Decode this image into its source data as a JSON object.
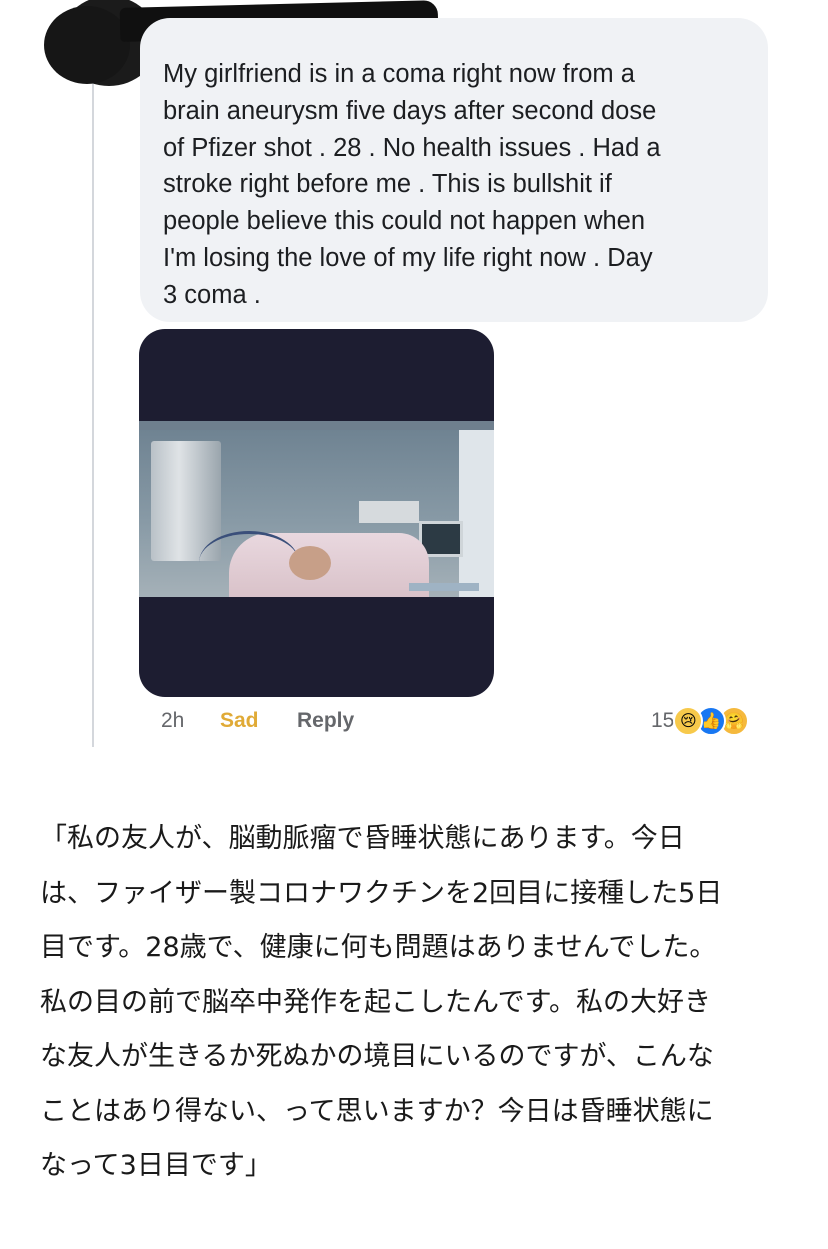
{
  "comment": {
    "text": "My girlfriend is in a coma right now from a\nbrain aneurysm five days after second dose\nof Pfizer shot . 28 . No health issues . Had a\nstroke right before me . This is bullshit if\npeople believe this could not happen when\nI'm losing the love of my life right now . Day\n3 coma ."
  },
  "actions": {
    "time": "2h",
    "reaction": "Sad",
    "reply": "Reply"
  },
  "reactions": {
    "count": "15",
    "icons": [
      "sad-icon",
      "like-icon",
      "care-icon"
    ]
  },
  "translation": {
    "text": "「私の友人が、脳動脈瘤で昏睡状態にあります。今日\nは、ファイザー製コロナワクチンを2回目に接種した5日\n目です。28歳で、健康に何も問題はありませんでした。\n私の目の前で脳卒中発作を起こしたんです。私の大好き\nな友人が生きるか死ぬかの境目にいるのですが、こんな\nことはあり得ない、って思いますか？今日は昏睡状態に\nなって3日目です」"
  },
  "colors": {
    "bubble": "#f0f2f5",
    "sad_accent": "#e0aa36",
    "muted": "#65676b",
    "like_blue": "#1877f2"
  }
}
